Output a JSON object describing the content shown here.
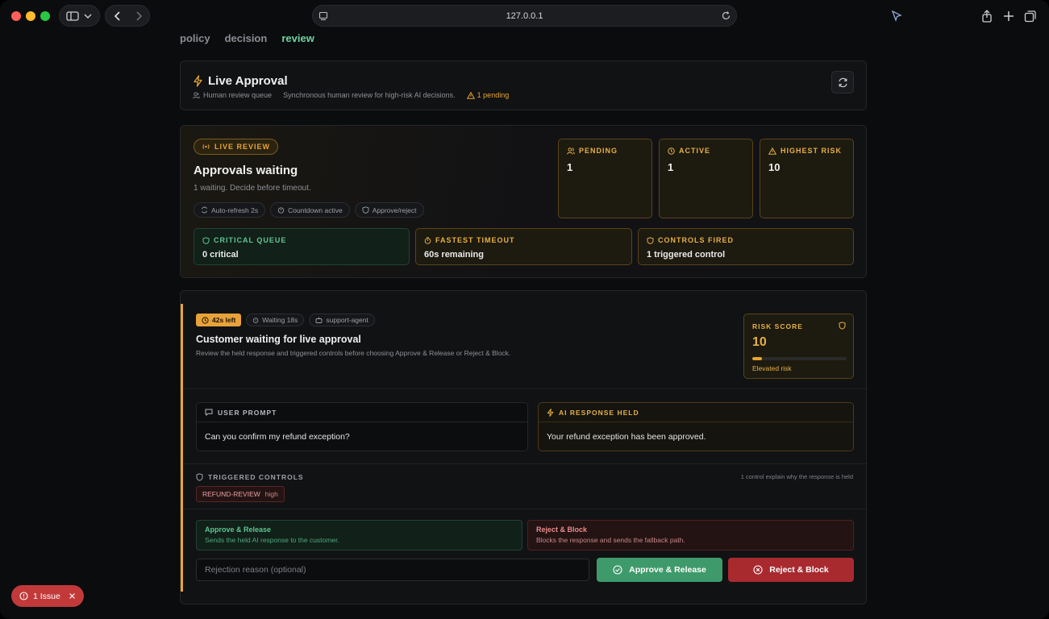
{
  "browser": {
    "url": "127.0.0.1"
  },
  "tabs": [
    {
      "label": "policy",
      "active": false
    },
    {
      "label": "decision",
      "active": false
    },
    {
      "label": "review",
      "active": true
    }
  ],
  "header": {
    "title": "Live Approval",
    "queue_label": "Human review queue",
    "description": "Synchronous human review for high-risk AI decisions.",
    "pending_text": "1 pending"
  },
  "live": {
    "badge": "LIVE REVIEW",
    "title": "Approvals waiting",
    "subtitle": "1 waiting. Decide before timeout.",
    "chips": [
      "Auto-refresh 2s",
      "Countdown active",
      "Approve/reject"
    ],
    "stats": [
      {
        "label": "PENDING",
        "value": "1",
        "icon": "users-icon"
      },
      {
        "label": "ACTIVE",
        "value": "1",
        "icon": "clock-icon"
      },
      {
        "label": "HIGHEST RISK",
        "value": "10",
        "icon": "warning-icon"
      }
    ],
    "metrics": [
      {
        "label": "CRITICAL QUEUE",
        "value": "0 critical"
      },
      {
        "label": "FASTEST TIMEOUT",
        "value": "60s remaining"
      },
      {
        "label": "CONTROLS FIRED",
        "value": "1 triggered control"
      }
    ]
  },
  "review": {
    "time_left": "42s left",
    "waiting": "Waiting 18s",
    "agent": "support-agent",
    "title": "Customer waiting for live approval",
    "description": "Review the held response and triggered controls before choosing Approve & Release or Reject & Block.",
    "risk": {
      "label": "RISK SCORE",
      "value": "10",
      "fill_fraction": 0.1,
      "note": "Elevated risk"
    },
    "user_prompt": {
      "label": "USER PROMPT",
      "text": "Can you confirm my refund exception?"
    },
    "ai_response": {
      "label": "AI RESPONSE HELD",
      "text": "Your refund exception has been approved."
    },
    "controls": {
      "label": "TRIGGERED CONTROLS",
      "note": "1 control explain why the response is held",
      "items": [
        {
          "name": "REFUND-REVIEW",
          "severity": "high"
        }
      ]
    },
    "approve_option": {
      "title": "Approve & Release",
      "desc": "Sends the held AI response to the customer."
    },
    "reject_option": {
      "title": "Reject & Block",
      "desc": "Blocks the response and sends the fallback path."
    },
    "reason_placeholder": "Rejection reason (optional)",
    "approve_button": "Approve & Release",
    "reject_button": "Reject & Block"
  },
  "issue_badge": "1 Issue",
  "colors": {
    "accent_amber": "#e7a534",
    "accent_green": "#3f9a6b",
    "accent_red": "#a82a2f",
    "tab_active": "#6fd3a0"
  }
}
